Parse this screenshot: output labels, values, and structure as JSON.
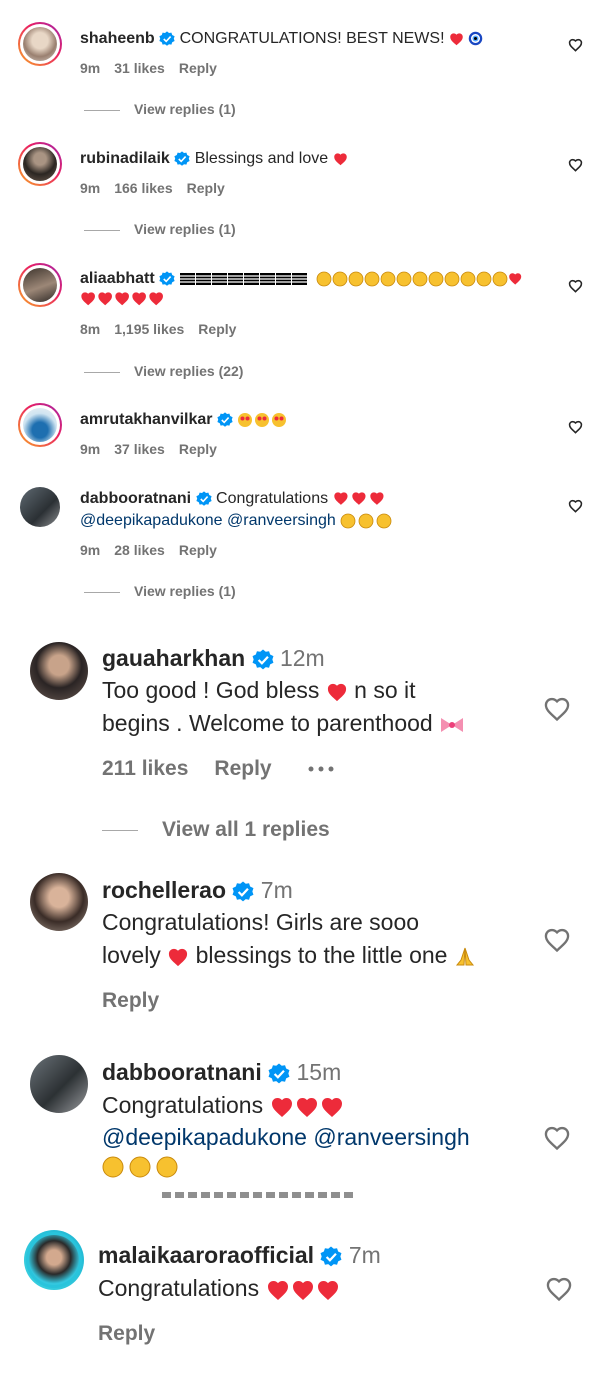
{
  "colors": {
    "text": "#262626",
    "muted": "#737373",
    "verified": "#0095f6",
    "heart": "#ed2b3a",
    "mention": "#00376b"
  },
  "icons": {
    "verified": "verified-badge-icon",
    "like": "heart-outline-icon",
    "more": "ellipsis-icon"
  },
  "comments_small": [
    {
      "username": "shaheenb",
      "text": "CONGRATULATIONS! BEST NEWS!",
      "emoji": "heart-evil-eye",
      "time": "9m",
      "likes": "31 likes",
      "reply": "Reply",
      "view_replies": "View replies (1)"
    },
    {
      "username": "rubinadilaik",
      "text": "Blessings and love",
      "emoji": "heart",
      "time": "9m",
      "likes": "166 likes",
      "reply": "Reply",
      "view_replies": "View replies (1)"
    },
    {
      "username": "aliaabhatt",
      "text": "",
      "emoji": "flags-smiles-hearts",
      "time": "8m",
      "likes": "1,195 likes",
      "reply": "Reply",
      "view_replies": "View replies (22)"
    },
    {
      "username": "amrutakhanvilkar",
      "text": "",
      "emoji": "heart-eyes x3",
      "time": "9m",
      "likes": "37 likes",
      "reply": "Reply",
      "view_replies": ""
    },
    {
      "username": "dabbooratnani",
      "text": "Congratulations",
      "mentions": "@deepikapadukone @ranveersingh",
      "emoji": "hearts-hugs",
      "time": "9m",
      "likes": "28 likes",
      "reply": "Reply",
      "view_replies": "View replies (1)"
    }
  ],
  "comments_large": [
    {
      "username": "gauaharkhan",
      "time": "12m",
      "line1": "Too good ! God bless",
      "line1b": "n so it",
      "line2": "begins . Welcome to parenthood",
      "likes": "211 likes",
      "reply": "Reply",
      "view_all": "View all 1 replies"
    },
    {
      "username": "rochellerao",
      "time": "7m",
      "line1": "Congratulations! Girls are sooo",
      "line2a": "lovely",
      "line2b": "blessings to the little one",
      "reply": "Reply"
    },
    {
      "username": "dabbooratnani",
      "time": "15m",
      "line1": "Congratulations",
      "mentions": "@deepikapadukone @ranveersingh"
    },
    {
      "username": "malaikaaroraofficial",
      "time": "7m",
      "line1": "Congratulations",
      "reply": "Reply"
    }
  ]
}
